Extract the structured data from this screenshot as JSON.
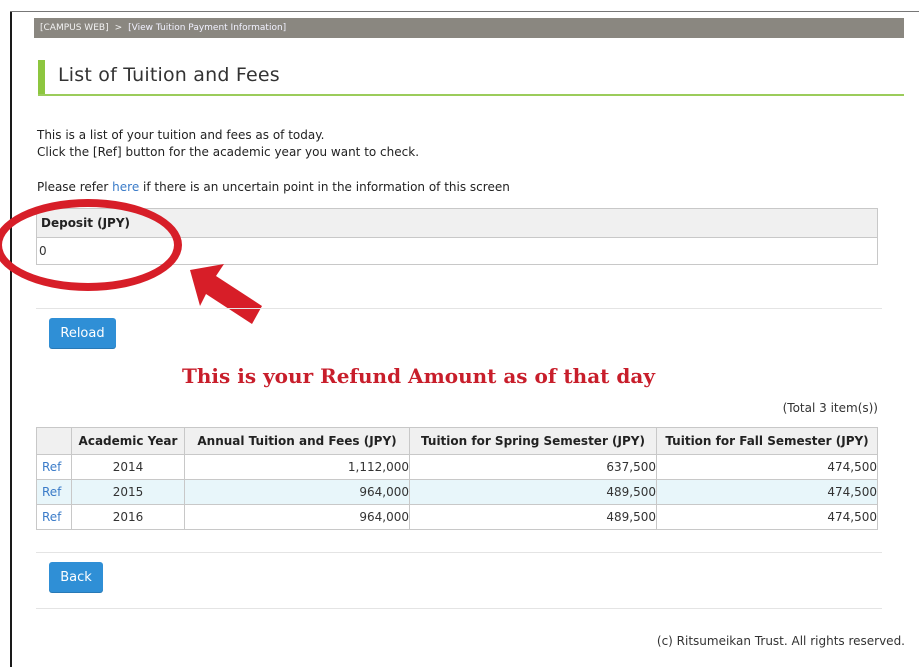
{
  "breadcrumb": {
    "root": "[CAMPUS WEB]",
    "separator": ">",
    "current": "[View Tuition Payment Information]"
  },
  "page_title": "List of Tuition and Fees",
  "intro": {
    "line1": "This is a list of your tuition and fees as of today.",
    "line2": "Click the [Ref] button for the academic year you want to check."
  },
  "refer": {
    "prefix": "Please refer ",
    "link": "here",
    "suffix": " if there is an uncertain point in the information of this screen"
  },
  "deposit": {
    "header": "Deposit (JPY)",
    "value": "0"
  },
  "reload_label": "Reload",
  "annotation": "This is your Refund Amount as of that day",
  "total_items": "(Total 3 item(s))",
  "fees_table": {
    "headers": [
      "",
      "Academic Year",
      "Annual Tuition and Fees (JPY)",
      "Tuition for Spring Semester (JPY)",
      "Tuition for Fall Semester (JPY)"
    ],
    "rows": [
      {
        "ref": "Ref",
        "year": "2014",
        "annual": "1,112,000",
        "spring": "637,500",
        "fall": "474,500"
      },
      {
        "ref": "Ref",
        "year": "2015",
        "annual": "964,000",
        "spring": "489,500",
        "fall": "474,500"
      },
      {
        "ref": "Ref",
        "year": "2016",
        "annual": "964,000",
        "spring": "489,500",
        "fall": "474,500"
      }
    ]
  },
  "back_label": "Back",
  "footer": "(c) Ritsumeikan Trust. All rights reserved.",
  "colors": {
    "breadcrumb_bg": "#8a8780",
    "title_accent": "#8dc63f",
    "button": "#2f8fd6",
    "annotation_red": "#d71e28",
    "link": "#3a7bc8",
    "alt_row": "#e8f6fa"
  }
}
